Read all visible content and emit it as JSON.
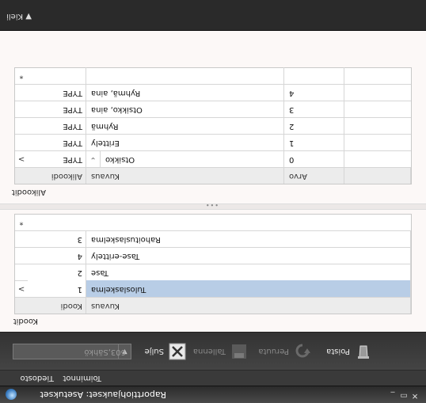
{
  "window": {
    "title": "Raporttiohjaukset: Asetukset"
  },
  "menu": {
    "items": [
      "Tiedosto",
      "Toiminnot"
    ]
  },
  "toolbar": {
    "combo_value": "603,Sähkö",
    "buttons": [
      {
        "label": "Sulje",
        "icon": "close-icon",
        "enabled": true
      },
      {
        "label": "Tallenna",
        "icon": "save-icon",
        "enabled": false
      },
      {
        "label": "Peruuta",
        "icon": "undo-icon",
        "enabled": false
      },
      {
        "label": "Poista",
        "icon": "delete-icon",
        "enabled": true
      }
    ]
  },
  "koodit": {
    "label": "Koodit",
    "headers": [
      "Koodi",
      "Kuvaus"
    ],
    "rows": [
      {
        "koodi": "1",
        "kuvaus": "Tuloslaskelma"
      },
      {
        "koodi": "2",
        "kuvaus": "Tase"
      },
      {
        "koodi": "4",
        "kuvaus": "Tase-erittely"
      },
      {
        "koodi": "3",
        "kuvaus": "Rahoituslaskelma"
      }
    ],
    "new_row_marker": "*",
    "current_marker": ">"
  },
  "alikoodit": {
    "label": "Alikoodit",
    "headers": [
      "Alikoodi",
      "Kuvaus",
      "Arvo"
    ],
    "rows": [
      {
        "alikoodi": "TYPE",
        "kuvaus": "Otsikko",
        "arvo": "0"
      },
      {
        "alikoodi": "TYPE",
        "kuvaus": "Erittely",
        "arvo": "1"
      },
      {
        "alikoodi": "TYPE",
        "kuvaus": "Ryhmä",
        "arvo": "2"
      },
      {
        "alikoodi": "TYPE",
        "kuvaus": "Otsikko, aina",
        "arvo": "3"
      },
      {
        "alikoodi": "TYPE",
        "kuvaus": "Ryhmä, aina",
        "arvo": "4"
      }
    ],
    "new_row_marker": "*",
    "current_marker": ">"
  },
  "statusbar": {
    "language": "Kieli"
  },
  "colors": {
    "selection": "#b8cde6",
    "chrome_dark": "#333333",
    "content_bg": "#fcf8f7"
  }
}
